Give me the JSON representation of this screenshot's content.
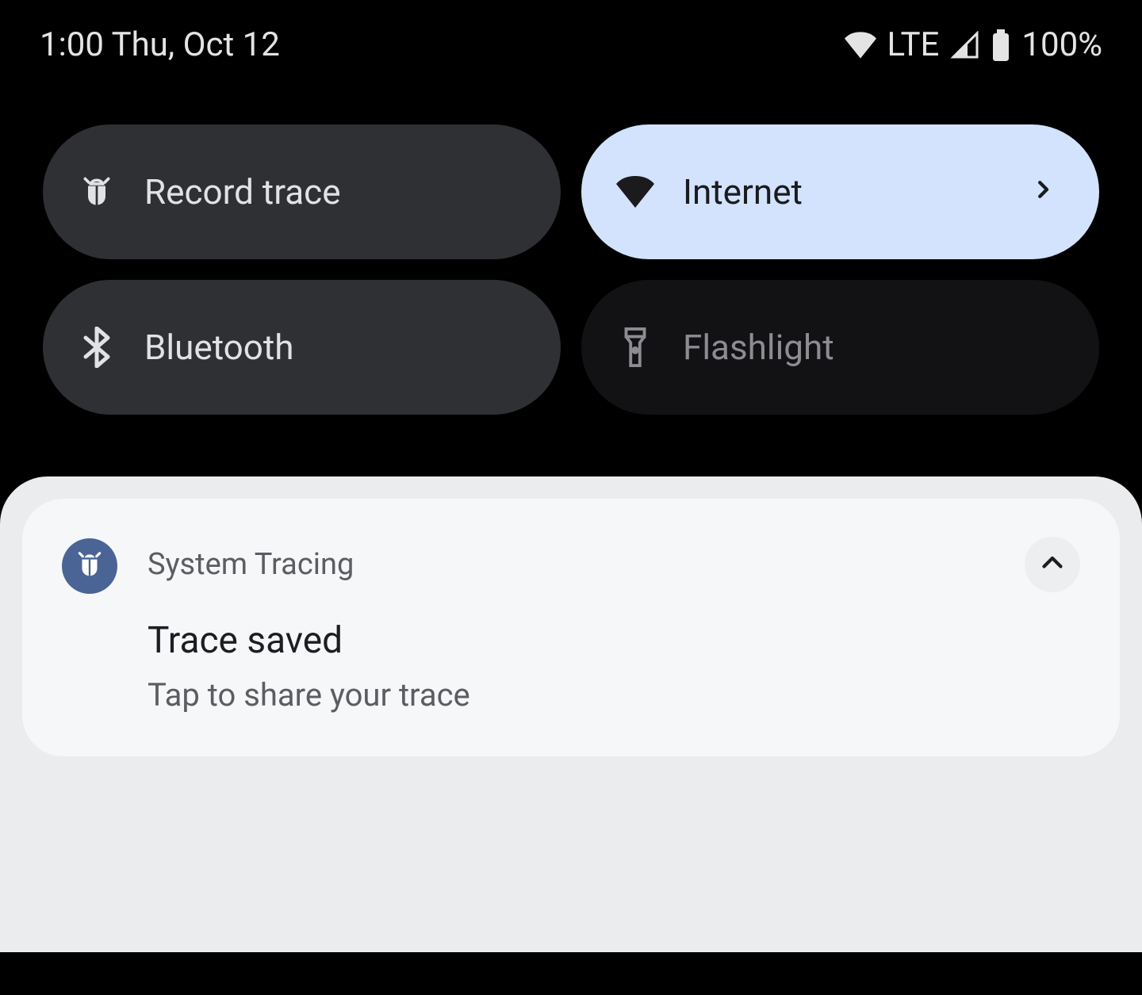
{
  "status_bar": {
    "time_date": "1:00 Thu, Oct 12",
    "network_label": "LTE",
    "battery_pct": "100%"
  },
  "quick_settings": {
    "tiles": [
      {
        "label": "Record trace",
        "state": "off",
        "icon": "bug-icon",
        "has_chevron": false
      },
      {
        "label": "Internet",
        "state": "on",
        "icon": "wifi-icon",
        "has_chevron": true
      },
      {
        "label": "Bluetooth",
        "state": "off",
        "icon": "bluetooth-icon",
        "has_chevron": false
      },
      {
        "label": "Flashlight",
        "state": "disabled",
        "icon": "flashlight-icon",
        "has_chevron": false
      }
    ]
  },
  "notifications": [
    {
      "app_name": "System Tracing",
      "title": "Trace saved",
      "body": "Tap to share your trace",
      "icon": "bug-icon"
    }
  ]
}
